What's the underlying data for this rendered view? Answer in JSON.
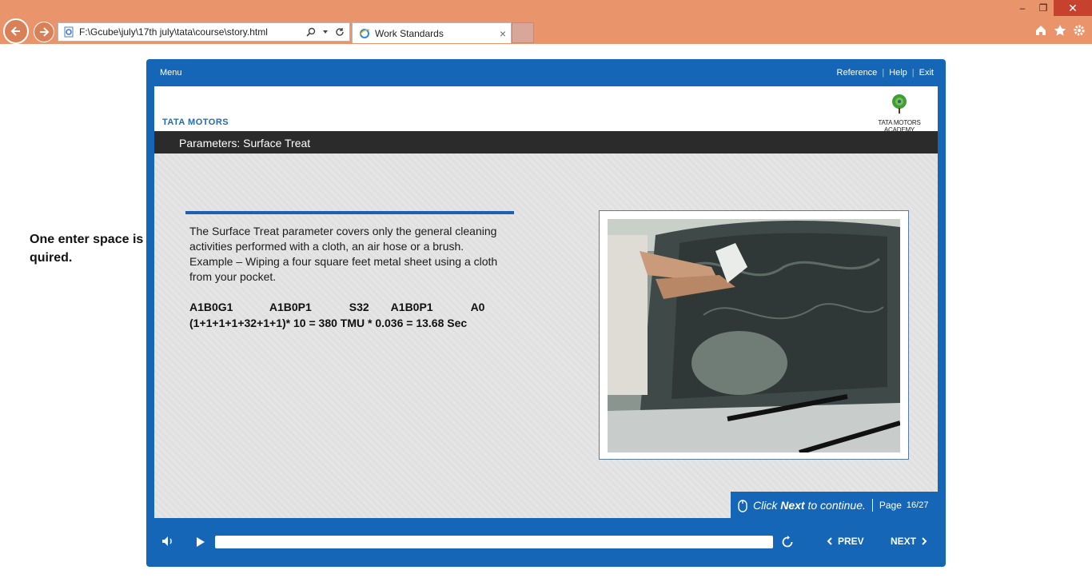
{
  "browser": {
    "address": "F:\\Gcube\\july\\17th july\\tata\\course\\story.html",
    "tab_title": "Work Standards",
    "tab_close": "×",
    "min": "–",
    "max": "❐",
    "close": "✕"
  },
  "annotation": {
    "line1": "One enter space is",
    "line2": "quired."
  },
  "player": {
    "menu": "Menu",
    "links": [
      "Reference",
      "Help",
      "Exit"
    ],
    "separator": "|",
    "brand": "TATA MOTORS",
    "academy": "TATA MOTORS ACADEMY",
    "slide_title": "Parameters: Surface Treat",
    "body_lines": [
      "The Surface Treat parameter covers only the general cleaning",
      "activities performed with a cloth, an air hose or a brush.",
      "Example – Wiping a four square feet metal sheet using a cloth",
      "from your pocket."
    ],
    "codes": [
      "A1B0G1",
      "A1B0P1",
      "S32",
      "A1B0P1",
      "A0"
    ],
    "formula": "(1+1+1+1+32+1+1)* 10 = 380 TMU * 0.036 = 13.68 Sec",
    "continue_prefix": "Click",
    "continue_bold": "Next",
    "continue_suffix": "to continue.",
    "page_label": "Page",
    "page_num": "16/27",
    "prev": "PREV",
    "next": "NEXT",
    "colors": {
      "frame": "#1566b6",
      "title_bar": "#2b2b2b",
      "accent_rule": "#1f5fb0",
      "browser_chrome": "#e9946a"
    }
  }
}
